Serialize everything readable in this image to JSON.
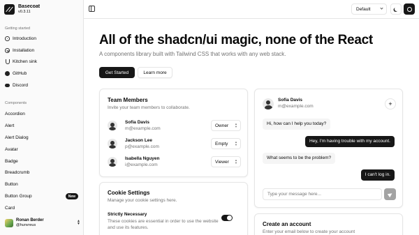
{
  "brand": {
    "name": "Basecoat",
    "version": "v0.3.11"
  },
  "sidebar": {
    "getting_started_label": "Getting started",
    "getting_started": [
      {
        "label": "Introduction",
        "icon": "circle-dot-icon"
      },
      {
        "label": "Installation",
        "icon": "download-icon"
      },
      {
        "label": "Kitchen sink",
        "icon": "flask-icon"
      },
      {
        "label": "GitHub",
        "icon": "github-icon"
      },
      {
        "label": "Discord",
        "icon": "discord-icon"
      }
    ],
    "components_label": "Components",
    "components": [
      {
        "label": "Accordion"
      },
      {
        "label": "Alert"
      },
      {
        "label": "Alert Dialog"
      },
      {
        "label": "Avatar"
      },
      {
        "label": "Badge"
      },
      {
        "label": "Breadcrumb"
      },
      {
        "label": "Button"
      },
      {
        "label": "Button Group",
        "badge": "New"
      },
      {
        "label": "Card"
      }
    ],
    "user": {
      "name": "Ronan Berder",
      "handle": "@hunvreus"
    }
  },
  "topbar": {
    "theme_value": "Default"
  },
  "hero": {
    "title": "All of the shadcn/ui magic, none of the React",
    "subtitle": "A components library built with Tailwind CSS that works with any web stack.",
    "primary_button": "Get Started",
    "secondary_button": "Learn more"
  },
  "team_card": {
    "title": "Team Members",
    "description": "Invite your team members to collaborate.",
    "members": [
      {
        "name": "Sofia Davis",
        "email": "m@example.com",
        "role": "Owner"
      },
      {
        "name": "Jackson Lee",
        "email": "p@example.com",
        "role": "Empty"
      },
      {
        "name": "Isabella Nguyen",
        "email": "i@example.com",
        "role": "Viewer"
      }
    ]
  },
  "cookie_card": {
    "title": "Cookie Settings",
    "description": "Manage your cookie settings here.",
    "setting_title": "Strictly Necessary",
    "setting_desc_line1": "These cookies are essential in order to use the website",
    "setting_desc_line2": "and use its features.",
    "enabled": true
  },
  "chat_card": {
    "name": "Sofia Davis",
    "email": "m@example.com",
    "messages": [
      {
        "from": "them",
        "text": "Hi, how can I help you today?"
      },
      {
        "from": "me",
        "text": "Hey, I'm having trouble with my account."
      },
      {
        "from": "them",
        "text": "What seems to be the problem?"
      },
      {
        "from": "me",
        "text": "I can't log in."
      }
    ],
    "input_placeholder": "Type your message here..."
  },
  "account_card": {
    "title": "Create an account",
    "description": "Enter your email below to create your account"
  },
  "colors": {
    "primary": "#171717",
    "muted": "#737373",
    "border": "#e5e5e5",
    "sidebar_bg": "#fafafa"
  }
}
